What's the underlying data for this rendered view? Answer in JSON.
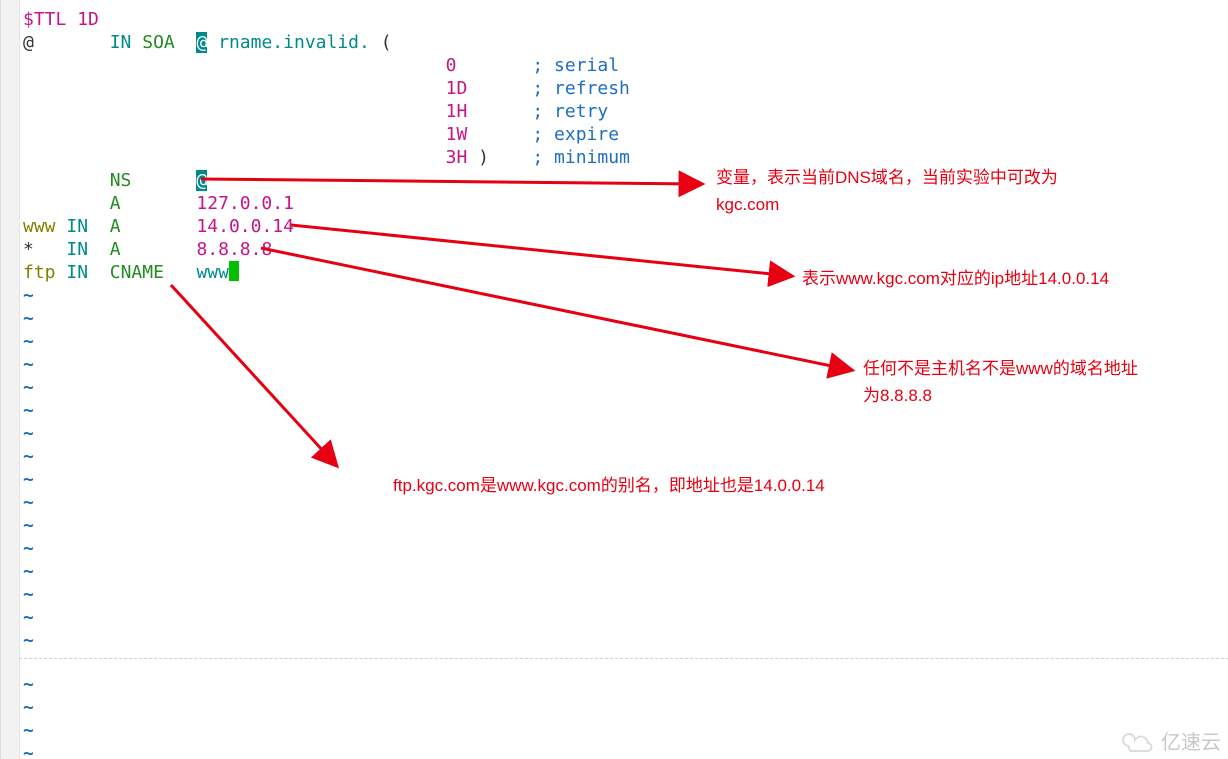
{
  "code": {
    "ttl_directive": "$TTL",
    "ttl_value": "1D",
    "origin": "@",
    "in": "IN",
    "soa": "SOA",
    "soa_mname": "@",
    "soa_rname": "rname.invalid.",
    "open_paren": "(",
    "close_paren": ")",
    "soa_params": [
      {
        "value": "0",
        "comment": "; serial"
      },
      {
        "value": "1D",
        "comment": "; refresh"
      },
      {
        "value": "1H",
        "comment": "; retry"
      },
      {
        "value": "1W",
        "comment": "; expire"
      },
      {
        "value": "3H",
        "comment": "; minimum"
      }
    ],
    "records": [
      {
        "name": "",
        "in": "",
        "type": "NS",
        "value": "@"
      },
      {
        "name": "",
        "in": "",
        "type": "A",
        "value": "127.0.0.1"
      },
      {
        "name": "www",
        "in": "IN",
        "type": "A",
        "value": "14.0.0.14"
      },
      {
        "name": "*",
        "in": "IN",
        "type": "A",
        "value": "8.8.8.8"
      },
      {
        "name": "ftp",
        "in": "IN",
        "type": "CNAME",
        "value": "www"
      }
    ],
    "tilde": "~"
  },
  "annotations": {
    "a1_line1": "变量，表示当前DNS域名，当前实验中可改为",
    "a1_line2": "kgc.com",
    "a2": "表示www.kgc.com对应的ip地址14.0.0.14",
    "a3_line1": "任何不是主机名不是www的域名地址",
    "a3_line2": "为8.8.8.8",
    "a4": "ftp.kgc.com是www.kgc.com的别名，即地址也是14.0.0.14"
  },
  "watermark": "亿速云"
}
